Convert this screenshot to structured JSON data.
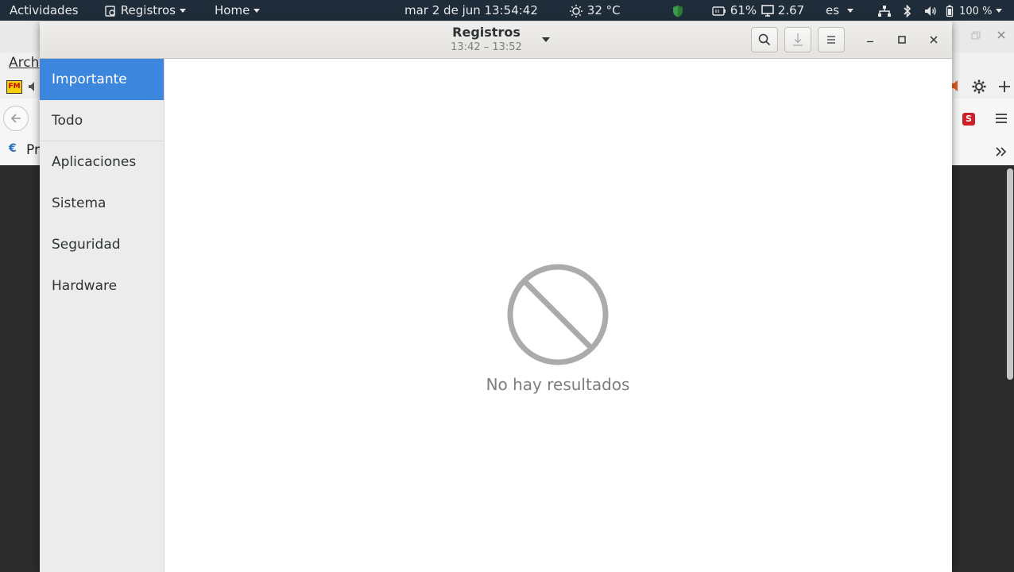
{
  "topbar": {
    "activities": "Actividades",
    "app_menu": "Registros",
    "home": "Home",
    "datetime": "mar  2 de jun 13:54:42",
    "weather": "32 °C",
    "battery_pct": "61%",
    "load": "2.67",
    "lang": "es",
    "power": "100 %"
  },
  "background_window": {
    "menu_fragment": "Arch",
    "bookmark_fragment": "Pr",
    "fm_badge": "FM",
    "s_badge": "S"
  },
  "logs_window": {
    "title": "Registros",
    "subtitle": "13:42 – 13:52",
    "sidebar": [
      {
        "label": "Importante",
        "active": true
      },
      {
        "label": "Todo",
        "active": false
      },
      {
        "label": "Aplicaciones",
        "active": false
      },
      {
        "label": "Sistema",
        "active": false
      },
      {
        "label": "Seguridad",
        "active": false
      },
      {
        "label": "Hardware",
        "active": false
      }
    ],
    "empty_message": "No hay resultados"
  }
}
